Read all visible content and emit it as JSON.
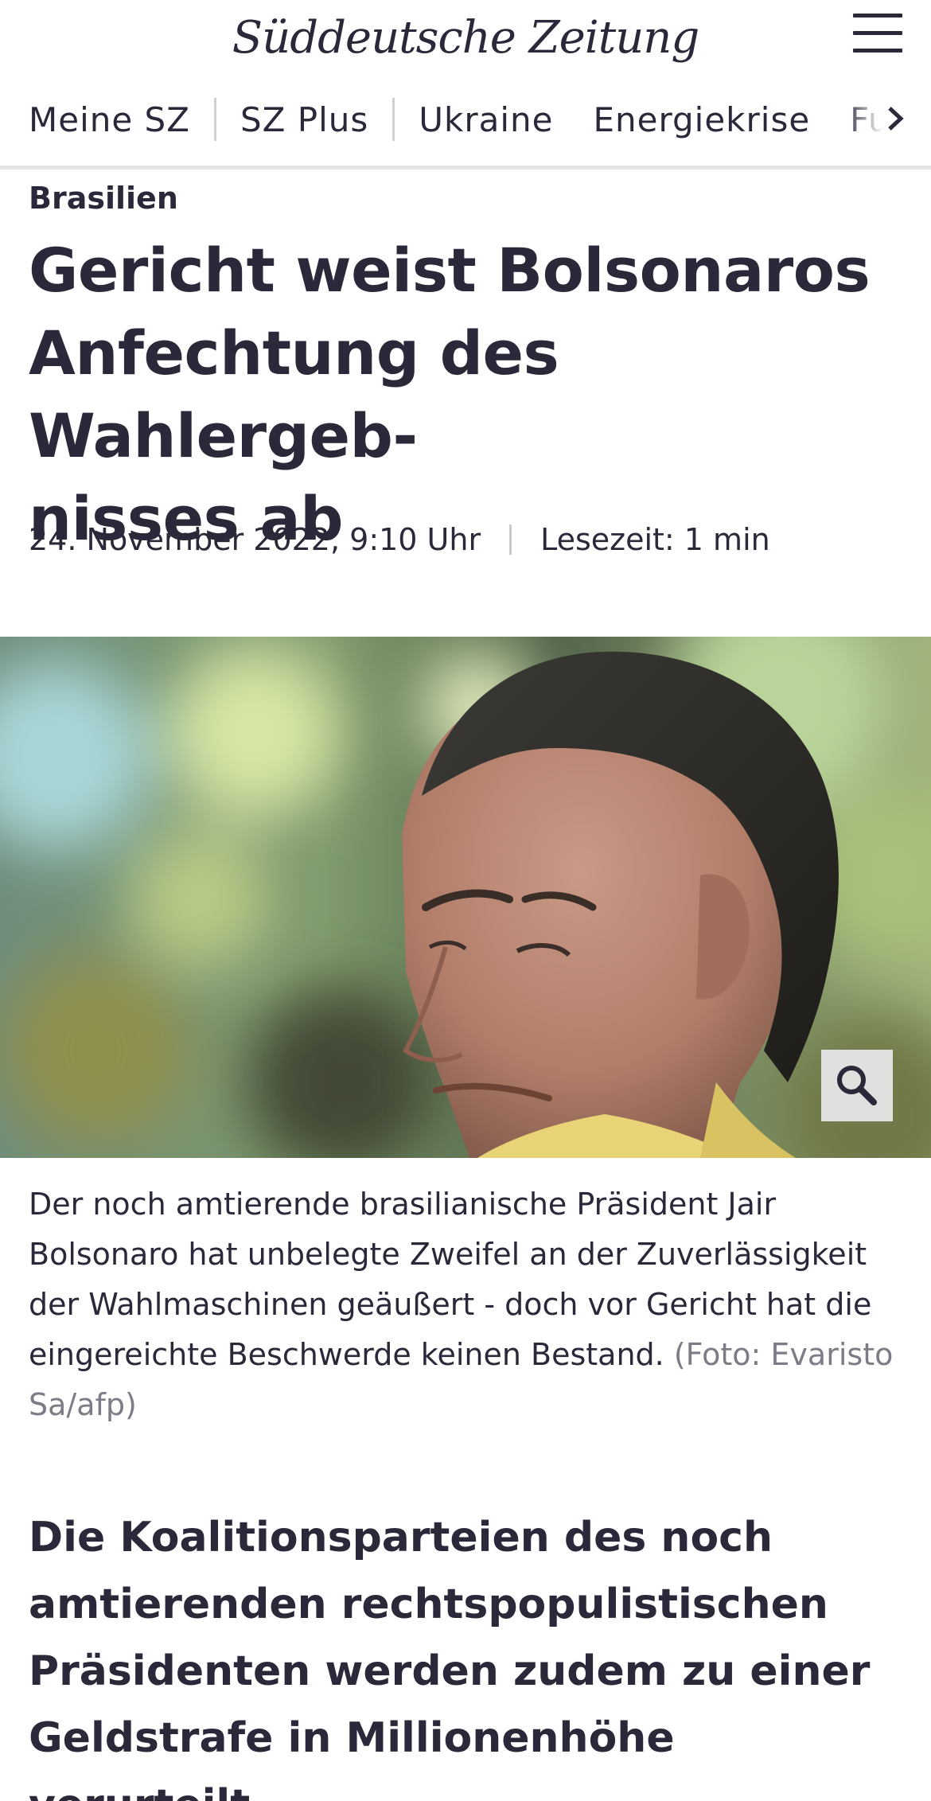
{
  "header": {
    "logo_text": "Süddeutsche Zeitung"
  },
  "nav": {
    "items": [
      "Meine SZ",
      "SZ Plus",
      "Ukraine",
      "Energiekrise",
      "Fu"
    ]
  },
  "article": {
    "kicker": "Brasilien",
    "headline_lines": [
      "Gericht weist Bolsonaros",
      "Anfechtung des Wahlergeb-",
      "nisses ab"
    ],
    "date": "24. November 2022, 9:10 Uhr",
    "reading_time": "Lesezeit: 1 min",
    "caption_text": "Der noch amtierende brasilianische Präsident Jair Bolsonaro hat unbelegte Zweifel an der Zuverlässigkeit der Wahlmaschinen geäußert - doch vor Gericht hat die eingereichte Beschwerde keinen Bestand.",
    "caption_credit": "(Foto: Evaristo Sa/afp)",
    "lead": "Die Koalitionsparteien des noch amtierenden rechtspopulistischen Präsidenten werden zudem zu einer Geldstrafe in Millionenhöhe verurteilt."
  },
  "icons": {
    "menu": "hamburger-menu-icon",
    "nav_scroll": "chevron-right-icon",
    "zoom": "magnifier-icon"
  },
  "colors": {
    "text": "#29293a",
    "credit": "#7c7c87",
    "divider": "#e5e5e8"
  }
}
